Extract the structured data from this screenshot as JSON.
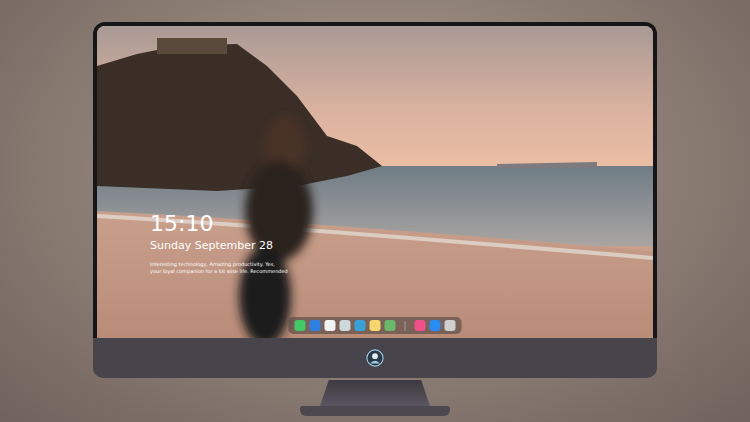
{
  "lock_screen": {
    "time": "15:10",
    "date": "Sunday September 28",
    "tagline": [
      "Interesting technology, Amazing productivity. Yes,",
      "your loyal companion for a lot wise life. Recommended"
    ]
  },
  "dock": {
    "apps": [
      {
        "kind": "app",
        "color": "#44c767"
      },
      {
        "kind": "app",
        "color": "#2f7fe0"
      },
      {
        "kind": "app",
        "color": "#f2f2f2"
      },
      {
        "kind": "app",
        "color": "#cfd8dc"
      },
      {
        "kind": "app",
        "color": "#3aa0d8"
      },
      {
        "kind": "app",
        "color": "#f5d76e"
      },
      {
        "kind": "app",
        "color": "#6cb86a"
      },
      {
        "kind": "separator",
        "color": "#9a9a9a"
      },
      {
        "kind": "app",
        "color": "#f0508a"
      },
      {
        "kind": "app",
        "color": "#2a8cf0"
      },
      {
        "kind": "app",
        "color": "#cfcfcf"
      }
    ]
  }
}
